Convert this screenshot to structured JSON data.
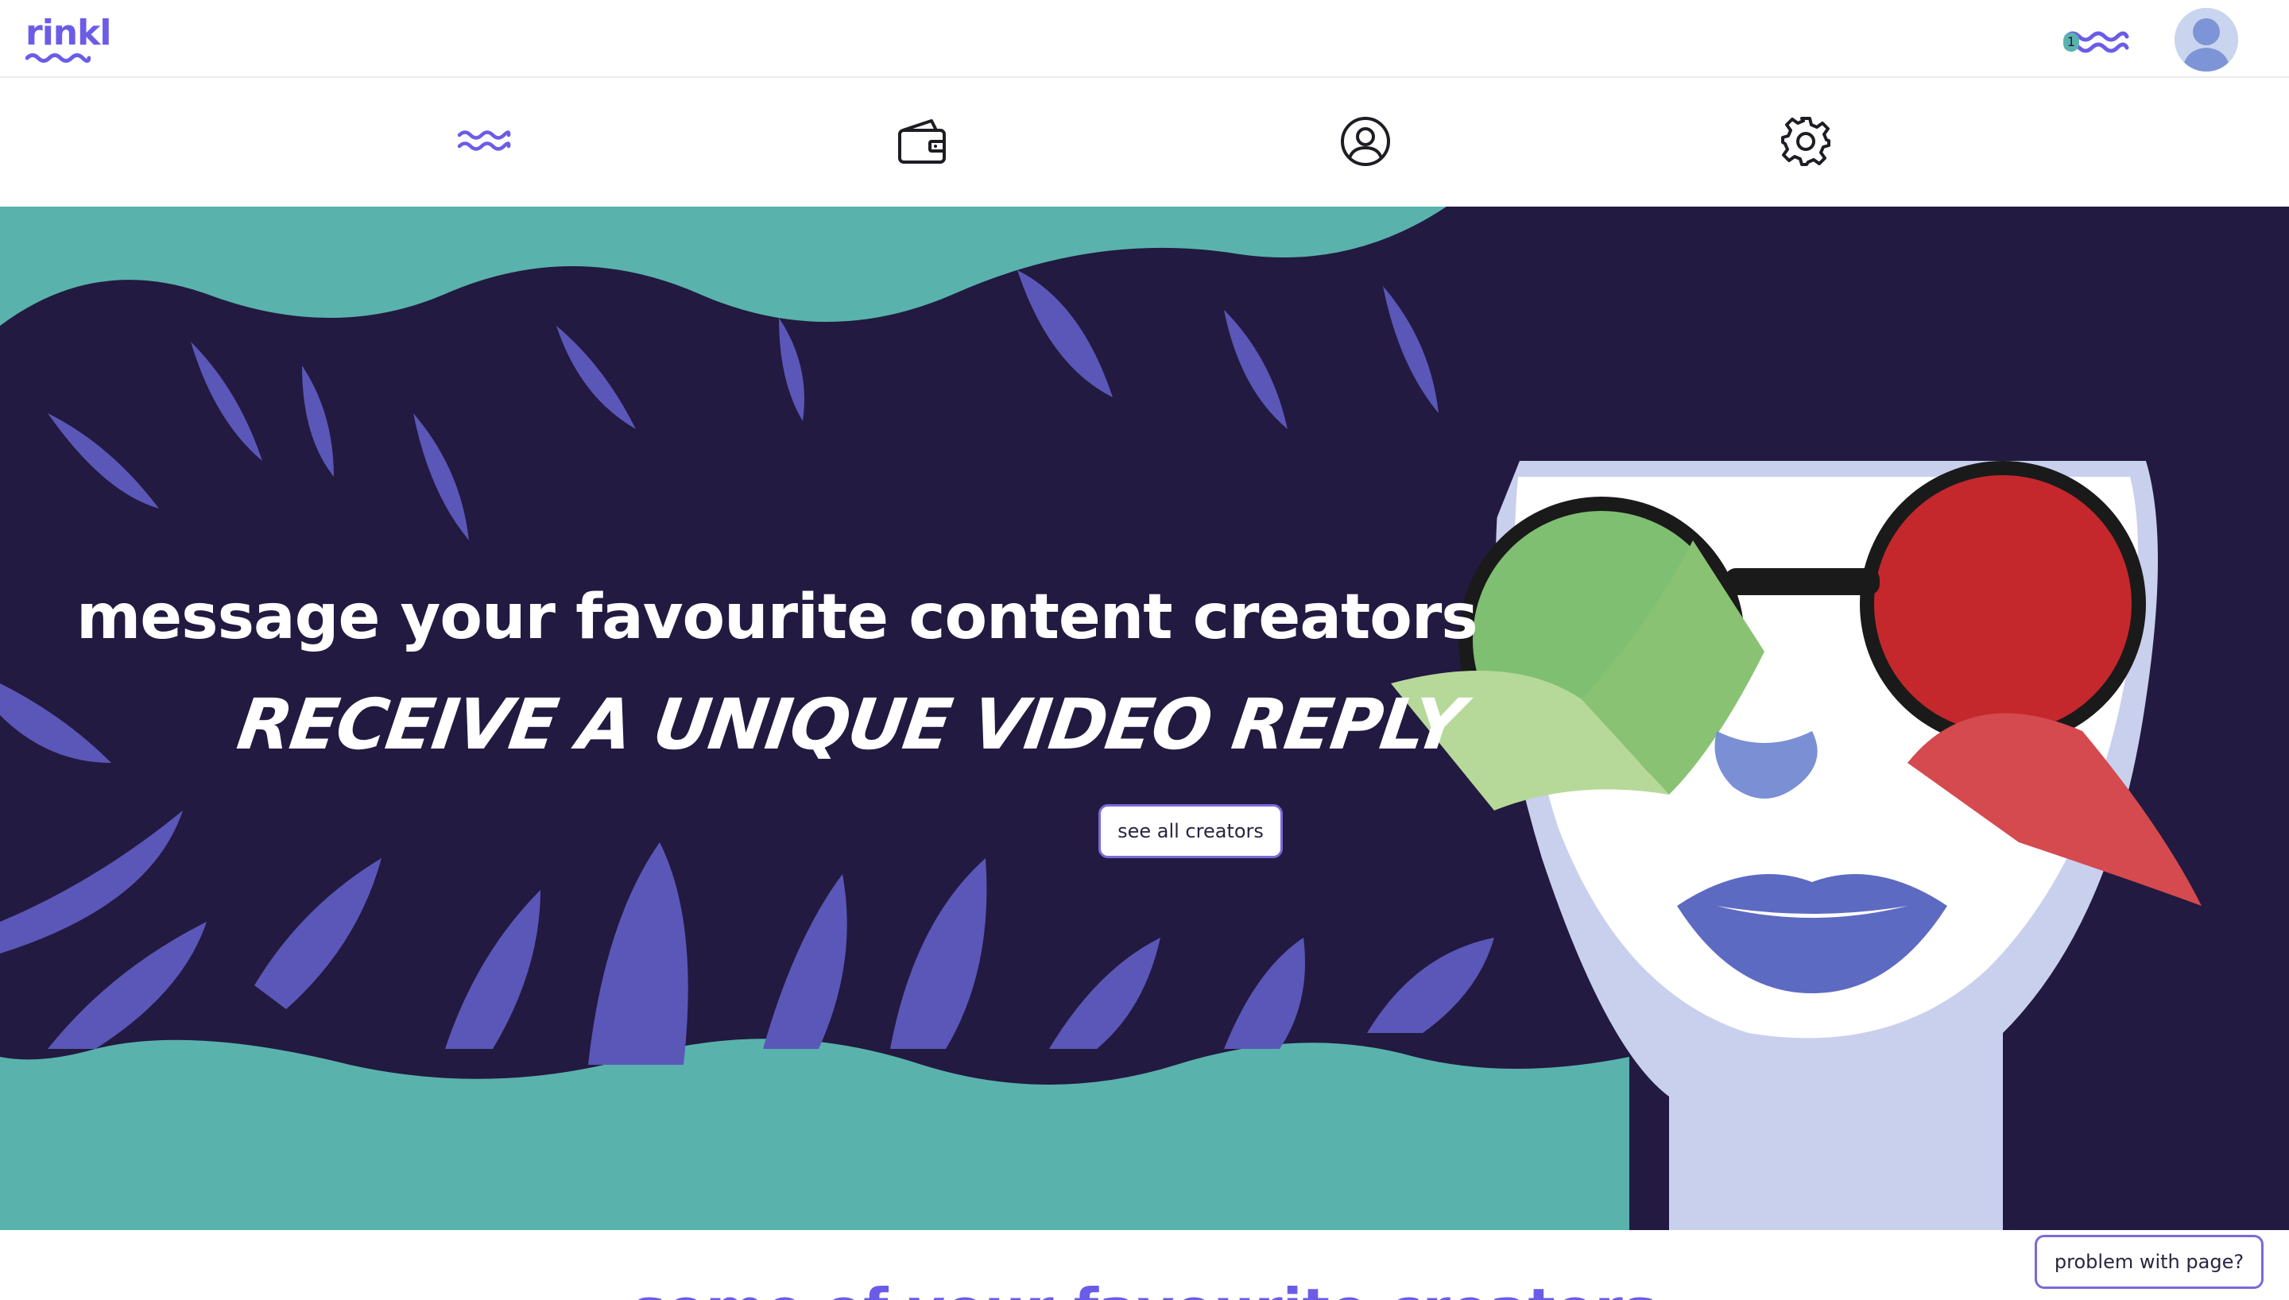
{
  "brand": {
    "name": "rinkl",
    "color": "#6b5ce7"
  },
  "header": {
    "coins_count": "1",
    "coins_icon": "rinkl-waves-icon",
    "avatar_icon": "user-avatar"
  },
  "nav": [
    {
      "id": "home",
      "icon": "rinkl-waves-icon"
    },
    {
      "id": "wallet",
      "icon": "wallet-icon"
    },
    {
      "id": "profile",
      "icon": "user-circle-icon"
    },
    {
      "id": "settings",
      "icon": "gear-icon"
    }
  ],
  "hero": {
    "title": "message your favourite content creators",
    "subtitle": "RECEIVE A UNIQUE VIDEO REPLY",
    "cta": "see all creators",
    "colors": {
      "teal": "#5ab2ad",
      "night": "#221a40",
      "leaf": "#5a57b8",
      "skin": "#ffffff"
    }
  },
  "section": {
    "title": "some of your favourite creators"
  },
  "footer_button": "problem with page?"
}
